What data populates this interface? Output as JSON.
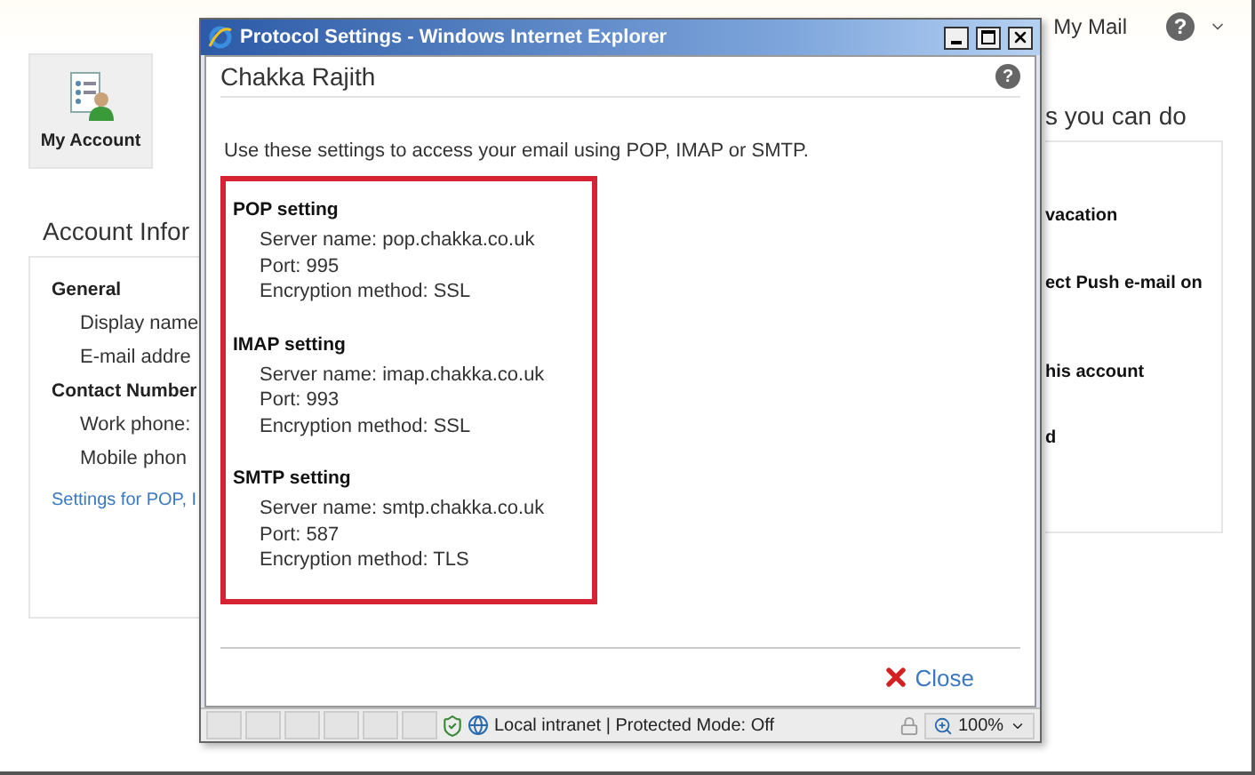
{
  "header": {
    "mail_link": "My Mail",
    "help": "?"
  },
  "nav_tile": {
    "label": "My Account",
    "selected": true
  },
  "account_panel": {
    "title": "Account Infor",
    "sections": [
      {
        "heading": "General",
        "fields": [
          "Display name",
          "E-mail addre"
        ]
      },
      {
        "heading": "Contact Number",
        "fields": [
          "Work phone:",
          "Mobile phon"
        ]
      }
    ],
    "link": "Settings for POP, I"
  },
  "actions_panel": {
    "title": "s you can do",
    "items": [
      "vacation",
      "ect Push e-mail on",
      "his account",
      "d"
    ]
  },
  "popup": {
    "title": "Protocol Settings - Windows Internet Explorer",
    "heading": "Chakka Rajith",
    "help": "?",
    "intro": "Use these settings to access your email using POP, IMAP or SMTP.",
    "settings": [
      {
        "title": "POP setting",
        "lines": [
          "Server name: pop.chakka.co.uk",
          "Port: 995",
          "Encryption method: SSL"
        ]
      },
      {
        "title": "IMAP setting",
        "lines": [
          "Server name: imap.chakka.co.uk",
          "Port: 993",
          "Encryption method: SSL"
        ]
      },
      {
        "title": "SMTP setting",
        "lines": [
          "Server name: smtp.chakka.co.uk",
          "Port: 587",
          "Encryption method: TLS"
        ]
      }
    ],
    "close": "Close",
    "status": {
      "zone": "Local intranet | Protected Mode: Off",
      "zoom": "100%"
    }
  }
}
